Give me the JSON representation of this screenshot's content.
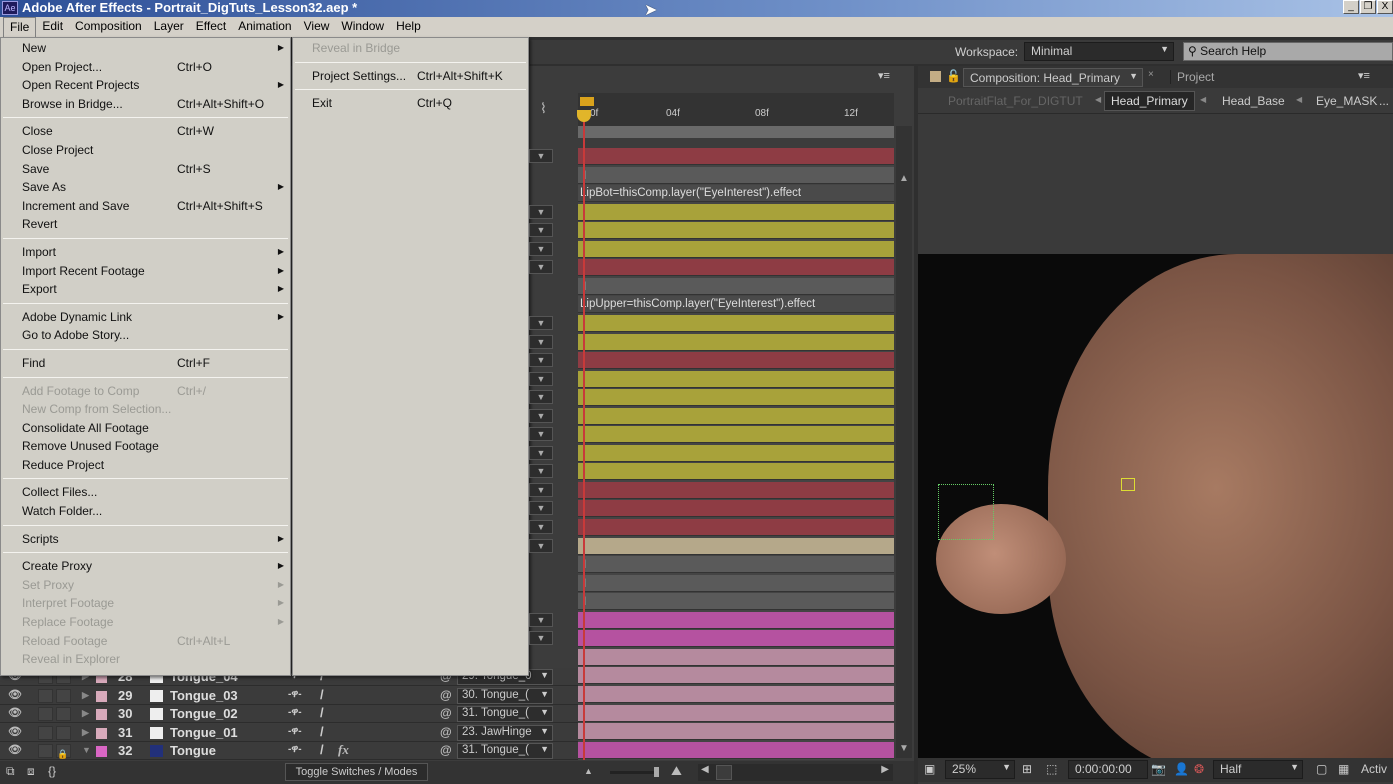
{
  "window": {
    "title": "Adobe After Effects - Portrait_DigTuts_Lesson32.aep *",
    "logo": "Ae",
    "controls": [
      "_",
      "❐",
      "X"
    ]
  },
  "menubar": [
    "File",
    "Edit",
    "Composition",
    "Layer",
    "Effect",
    "Animation",
    "View",
    "Window",
    "Help"
  ],
  "file_menu": [
    {
      "label": "New",
      "submenu": true
    },
    {
      "label": "Open Project...",
      "shortcut": "Ctrl+O"
    },
    {
      "label": "Open Recent Projects",
      "submenu": true
    },
    {
      "label": "Browse in Bridge...",
      "shortcut": "Ctrl+Alt+Shift+O"
    },
    {
      "sep": true
    },
    {
      "label": "Close",
      "shortcut": "Ctrl+W"
    },
    {
      "label": "Close Project"
    },
    {
      "label": "Save",
      "shortcut": "Ctrl+S"
    },
    {
      "label": "Save As",
      "submenu": true
    },
    {
      "label": "Increment and Save",
      "shortcut": "Ctrl+Alt+Shift+S"
    },
    {
      "label": "Revert"
    },
    {
      "sep": true
    },
    {
      "label": "Import",
      "submenu": true
    },
    {
      "label": "Import Recent Footage",
      "submenu": true
    },
    {
      "label": "Export",
      "submenu": true
    },
    {
      "sep": true
    },
    {
      "label": "Adobe Dynamic Link",
      "submenu": true
    },
    {
      "label": "Go to Adobe Story..."
    },
    {
      "sep": true
    },
    {
      "label": "Find",
      "shortcut": "Ctrl+F"
    },
    {
      "sep": true
    },
    {
      "label": "Add Footage to Comp",
      "shortcut": "Ctrl+/",
      "disabled": true
    },
    {
      "label": "New Comp from Selection...",
      "disabled": true
    },
    {
      "label": "Consolidate All Footage"
    },
    {
      "label": "Remove Unused Footage"
    },
    {
      "label": "Reduce Project"
    },
    {
      "sep": true
    },
    {
      "label": "Collect Files..."
    },
    {
      "label": "Watch Folder..."
    },
    {
      "sep": true
    },
    {
      "label": "Scripts",
      "submenu": true
    },
    {
      "sep": true
    },
    {
      "label": "Create Proxy",
      "submenu": true
    },
    {
      "label": "Set Proxy",
      "submenu": true,
      "disabled": true
    },
    {
      "label": "Interpret Footage",
      "submenu": true,
      "disabled": true
    },
    {
      "label": "Replace Footage",
      "submenu": true,
      "disabled": true
    },
    {
      "label": "Reload Footage",
      "shortcut": "Ctrl+Alt+L",
      "disabled": true
    },
    {
      "label": "Reveal in Explorer",
      "disabled": true
    }
  ],
  "file_submenu": [
    {
      "label": "Reveal in Bridge",
      "disabled": true
    },
    {
      "sep": true
    },
    {
      "label": "Project Settings...",
      "shortcut": "Ctrl+Alt+Shift+K"
    },
    {
      "sep": true
    },
    {
      "label": "Exit",
      "shortcut": "Ctrl+Q"
    }
  ],
  "workspace": {
    "label": "Workspace:",
    "value": "Minimal",
    "search_placeholder": "Search Help"
  },
  "viewer": {
    "tab": "Composition: Head_Primary",
    "tab2": "Project",
    "breadcrumbs": [
      "PortraitFlat_For_DIGTUT",
      "Head_Primary",
      "Head_Base",
      "Eye_MASK",
      "..."
    ],
    "zoom": "25%",
    "timecode": "0:00:00:00",
    "resolution": "Half",
    "view": "Activ"
  },
  "timeline": {
    "ruler": [
      "0f",
      "04f",
      "08f",
      "12f"
    ],
    "expressions": [
      "LipBot=thisComp.layer(\"EyeInterest\").effect",
      "LipUpper=thisComp.layer(\"EyeInterest\").effect"
    ],
    "toggle_label": "Toggle Switches / Modes",
    "layers": [
      {
        "num": "28",
        "name": "Tongue_04",
        "parent": "29. Tongue_0"
      },
      {
        "num": "29",
        "name": "Tongue_03",
        "parent": "30. Tongue_("
      },
      {
        "num": "30",
        "name": "Tongue_02",
        "parent": "31. Tongue_("
      },
      {
        "num": "31",
        "name": "Tongue_01",
        "parent": "23. JawHinge"
      },
      {
        "num": "32",
        "name": "Tongue",
        "parent": "31. Tongue_("
      }
    ],
    "track_colors": {
      "red": "#8e3c44",
      "yellow": "#a8a23a",
      "gray": "#5a5a5a",
      "tan": "#b5a88a",
      "pink": "#b552a0",
      "mauve": "#b58a9e",
      "expr": "#4a4a4a"
    },
    "tracks": [
      "red",
      "gray",
      "expr",
      "yellow",
      "yellow",
      "yellow",
      "red",
      "gray",
      "expr",
      "yellow",
      "yellow",
      "red",
      "yellow",
      "yellow",
      "yellow",
      "yellow",
      "yellow",
      "yellow",
      "red",
      "red",
      "red",
      "tan",
      "gray",
      "gray",
      "gray",
      "pink",
      "pink",
      "mauve",
      "mauve",
      "mauve",
      "mauve",
      "mauve",
      "pink"
    ]
  }
}
